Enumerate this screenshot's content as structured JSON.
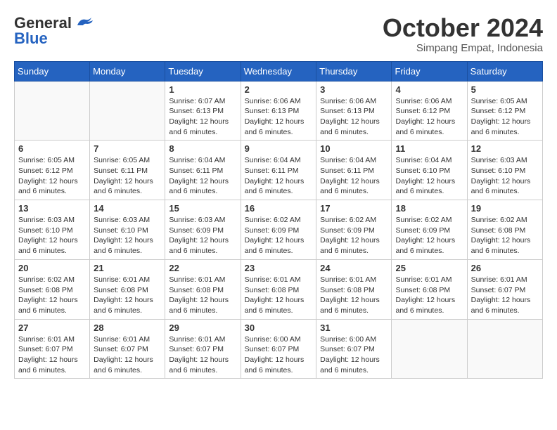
{
  "logo": {
    "general": "General",
    "blue": "Blue"
  },
  "title": {
    "month": "October 2024",
    "location": "Simpang Empat, Indonesia"
  },
  "weekdays": [
    "Sunday",
    "Monday",
    "Tuesday",
    "Wednesday",
    "Thursday",
    "Friday",
    "Saturday"
  ],
  "weeks": [
    [
      {
        "day": "",
        "info": ""
      },
      {
        "day": "",
        "info": ""
      },
      {
        "day": "1",
        "info": "Sunrise: 6:07 AM\nSunset: 6:13 PM\nDaylight: 12 hours and 6 minutes."
      },
      {
        "day": "2",
        "info": "Sunrise: 6:06 AM\nSunset: 6:13 PM\nDaylight: 12 hours and 6 minutes."
      },
      {
        "day": "3",
        "info": "Sunrise: 6:06 AM\nSunset: 6:13 PM\nDaylight: 12 hours and 6 minutes."
      },
      {
        "day": "4",
        "info": "Sunrise: 6:06 AM\nSunset: 6:12 PM\nDaylight: 12 hours and 6 minutes."
      },
      {
        "day": "5",
        "info": "Sunrise: 6:05 AM\nSunset: 6:12 PM\nDaylight: 12 hours and 6 minutes."
      }
    ],
    [
      {
        "day": "6",
        "info": "Sunrise: 6:05 AM\nSunset: 6:12 PM\nDaylight: 12 hours and 6 minutes."
      },
      {
        "day": "7",
        "info": "Sunrise: 6:05 AM\nSunset: 6:11 PM\nDaylight: 12 hours and 6 minutes."
      },
      {
        "day": "8",
        "info": "Sunrise: 6:04 AM\nSunset: 6:11 PM\nDaylight: 12 hours and 6 minutes."
      },
      {
        "day": "9",
        "info": "Sunrise: 6:04 AM\nSunset: 6:11 PM\nDaylight: 12 hours and 6 minutes."
      },
      {
        "day": "10",
        "info": "Sunrise: 6:04 AM\nSunset: 6:11 PM\nDaylight: 12 hours and 6 minutes."
      },
      {
        "day": "11",
        "info": "Sunrise: 6:04 AM\nSunset: 6:10 PM\nDaylight: 12 hours and 6 minutes."
      },
      {
        "day": "12",
        "info": "Sunrise: 6:03 AM\nSunset: 6:10 PM\nDaylight: 12 hours and 6 minutes."
      }
    ],
    [
      {
        "day": "13",
        "info": "Sunrise: 6:03 AM\nSunset: 6:10 PM\nDaylight: 12 hours and 6 minutes."
      },
      {
        "day": "14",
        "info": "Sunrise: 6:03 AM\nSunset: 6:10 PM\nDaylight: 12 hours and 6 minutes."
      },
      {
        "day": "15",
        "info": "Sunrise: 6:03 AM\nSunset: 6:09 PM\nDaylight: 12 hours and 6 minutes."
      },
      {
        "day": "16",
        "info": "Sunrise: 6:02 AM\nSunset: 6:09 PM\nDaylight: 12 hours and 6 minutes."
      },
      {
        "day": "17",
        "info": "Sunrise: 6:02 AM\nSunset: 6:09 PM\nDaylight: 12 hours and 6 minutes."
      },
      {
        "day": "18",
        "info": "Sunrise: 6:02 AM\nSunset: 6:09 PM\nDaylight: 12 hours and 6 minutes."
      },
      {
        "day": "19",
        "info": "Sunrise: 6:02 AM\nSunset: 6:08 PM\nDaylight: 12 hours and 6 minutes."
      }
    ],
    [
      {
        "day": "20",
        "info": "Sunrise: 6:02 AM\nSunset: 6:08 PM\nDaylight: 12 hours and 6 minutes."
      },
      {
        "day": "21",
        "info": "Sunrise: 6:01 AM\nSunset: 6:08 PM\nDaylight: 12 hours and 6 minutes."
      },
      {
        "day": "22",
        "info": "Sunrise: 6:01 AM\nSunset: 6:08 PM\nDaylight: 12 hours and 6 minutes."
      },
      {
        "day": "23",
        "info": "Sunrise: 6:01 AM\nSunset: 6:08 PM\nDaylight: 12 hours and 6 minutes."
      },
      {
        "day": "24",
        "info": "Sunrise: 6:01 AM\nSunset: 6:08 PM\nDaylight: 12 hours and 6 minutes."
      },
      {
        "day": "25",
        "info": "Sunrise: 6:01 AM\nSunset: 6:08 PM\nDaylight: 12 hours and 6 minutes."
      },
      {
        "day": "26",
        "info": "Sunrise: 6:01 AM\nSunset: 6:07 PM\nDaylight: 12 hours and 6 minutes."
      }
    ],
    [
      {
        "day": "27",
        "info": "Sunrise: 6:01 AM\nSunset: 6:07 PM\nDaylight: 12 hours and 6 minutes."
      },
      {
        "day": "28",
        "info": "Sunrise: 6:01 AM\nSunset: 6:07 PM\nDaylight: 12 hours and 6 minutes."
      },
      {
        "day": "29",
        "info": "Sunrise: 6:01 AM\nSunset: 6:07 PM\nDaylight: 12 hours and 6 minutes."
      },
      {
        "day": "30",
        "info": "Sunrise: 6:00 AM\nSunset: 6:07 PM\nDaylight: 12 hours and 6 minutes."
      },
      {
        "day": "31",
        "info": "Sunrise: 6:00 AM\nSunset: 6:07 PM\nDaylight: 12 hours and 6 minutes."
      },
      {
        "day": "",
        "info": ""
      },
      {
        "day": "",
        "info": ""
      }
    ]
  ]
}
